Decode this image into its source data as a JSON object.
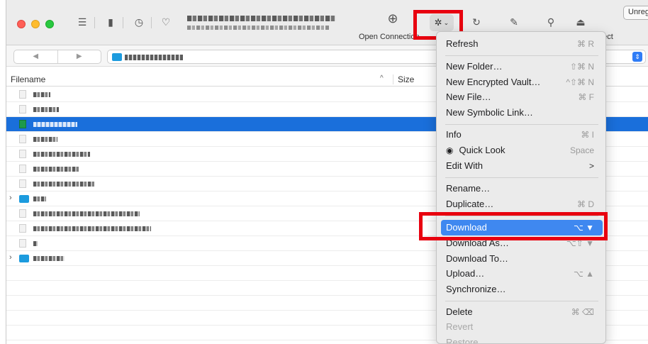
{
  "toolbar": {
    "open_connection_label": "Open Connection",
    "disconnect_label_partial": "nect",
    "unregistered_label": "Unreg"
  },
  "file_browser": {
    "columns": {
      "filename": "Filename",
      "size": "Size"
    }
  },
  "context_menu": {
    "items": [
      {
        "label": "Refresh",
        "shortcut": "⌘ R"
      },
      {
        "label": "New Folder…",
        "shortcut": "⇧⌘ N"
      },
      {
        "label": "New Encrypted Vault…",
        "shortcut": "^⇧⌘ N"
      },
      {
        "label": "New File…",
        "shortcut": "⌘ F"
      },
      {
        "label": "New Symbolic Link…",
        "shortcut": ""
      },
      {
        "label": "Info",
        "shortcut": "⌘ I"
      },
      {
        "label": "Quick Look",
        "shortcut": "Space"
      },
      {
        "label": "Edit With",
        "shortcut": ">"
      },
      {
        "label": "Rename…",
        "shortcut": ""
      },
      {
        "label": "Duplicate…",
        "shortcut": "⌘ D"
      },
      {
        "label": "Download",
        "shortcut": "⌥ ▼"
      },
      {
        "label": "Download As…",
        "shortcut": "⌥⇧ ▼"
      },
      {
        "label": "Download To…",
        "shortcut": ""
      },
      {
        "label": "Upload…",
        "shortcut": "⌥ ▲"
      },
      {
        "label": "Synchronize…",
        "shortcut": ""
      },
      {
        "label": "Delete",
        "shortcut": "⌘ ⌫"
      },
      {
        "label": "Revert",
        "shortcut": ""
      },
      {
        "label": "Restore",
        "shortcut": ""
      }
    ]
  },
  "colors": {
    "selection": "#1a6fdb",
    "menu_highlight": "#3f88f0",
    "annotation_red": "#e8000f",
    "folder_blue": "#1c9bde"
  }
}
